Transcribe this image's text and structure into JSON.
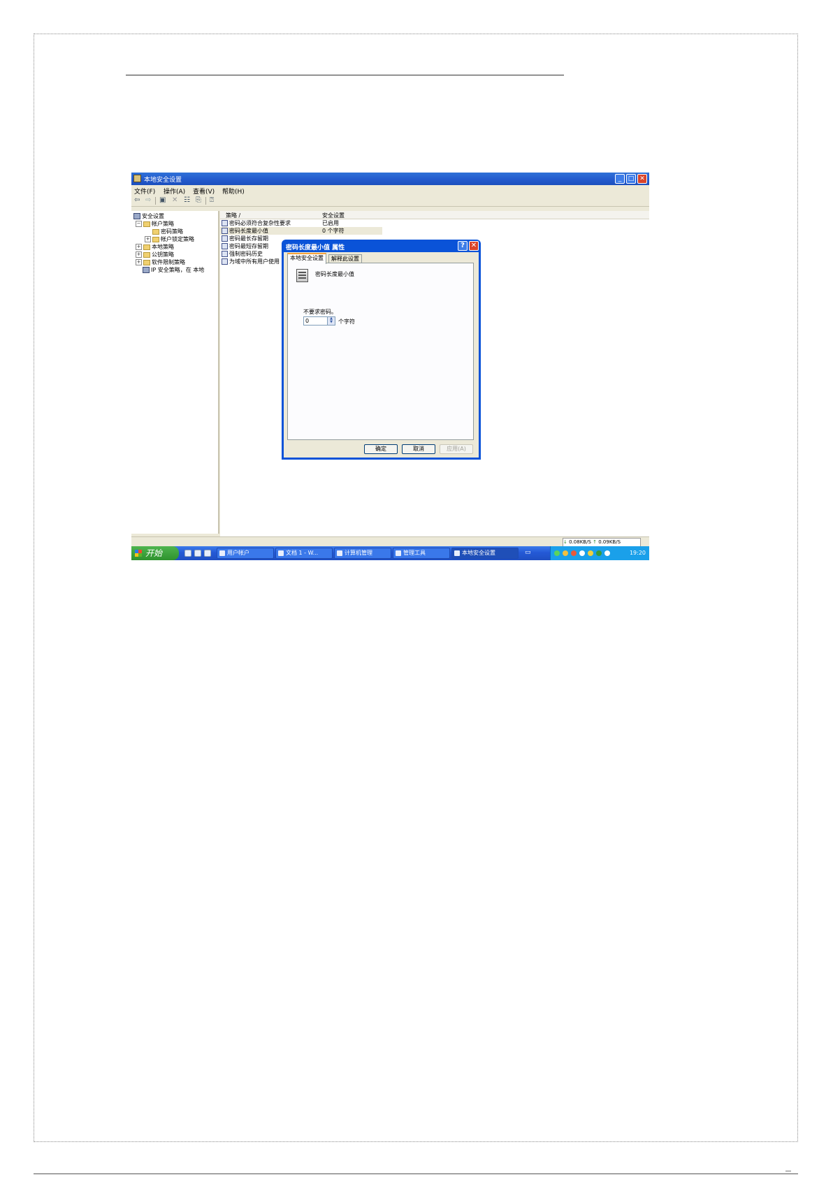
{
  "window": {
    "title": "本地安全设置",
    "min_label": "_",
    "max_label": "□",
    "close_label": "✕"
  },
  "menu": [
    "文件(F)",
    "操作(A)",
    "查看(V)",
    "帮助(H)"
  ],
  "toolbar_icons": [
    "back-arrow-icon",
    "forward-arrow-icon",
    "up-folder-icon",
    "delete-icon",
    "properties-icon",
    "export-icon",
    "help-icon"
  ],
  "tree": {
    "items": [
      {
        "label": "安全设置",
        "icon": "security-settings-icon"
      },
      {
        "label": "帐户策略",
        "icon": "folder-icon",
        "expander": "−"
      },
      {
        "label": "密码策略",
        "icon": "folder-icon"
      },
      {
        "label": "帐户锁定策略",
        "icon": "folder-icon",
        "expander": "+"
      },
      {
        "label": "本地策略",
        "icon": "folder-icon",
        "expander": "+"
      },
      {
        "label": "公钥策略",
        "icon": "folder-icon",
        "expander": "+"
      },
      {
        "label": "软件限制策略",
        "icon": "folder-icon",
        "expander": "+"
      },
      {
        "label": "IP 安全策略，在 本地",
        "icon": "ip-policy-icon"
      }
    ]
  },
  "list": {
    "columns": [
      "策略 /",
      "安全设置"
    ],
    "rows": [
      {
        "name": "密码必须符合复杂性要求",
        "value": "已启用"
      },
      {
        "name": "密码长度最小值",
        "value": "0 个字符"
      },
      {
        "name": "密码最长存留期",
        "value": ""
      },
      {
        "name": "密码最短存留期",
        "value": ""
      },
      {
        "name": "强制密码历史",
        "value": ""
      },
      {
        "name": "为域中所有用户使用",
        "value": ""
      }
    ]
  },
  "dialog": {
    "title": "密码长度最小值 属性",
    "help_label": "?",
    "close_label": "✕",
    "tabs": [
      "本地安全设置",
      "解释此设置"
    ],
    "policy_name": "密码长度最小值",
    "requirement_label": "不要求密码。",
    "value": "0",
    "unit": "个字符",
    "buttons": {
      "ok": "确定",
      "cancel": "取消",
      "apply": "应用(A)"
    }
  },
  "status": {
    "download": "0.08KB/S",
    "upload": "0.09KB/S"
  },
  "taskbar": {
    "start_label": "开始",
    "tasks": [
      "用户帐户",
      "文档 1 - W...",
      "计算机管理",
      "管理工具",
      "本地安全设置"
    ],
    "clock": "19:20"
  },
  "colors": {
    "xp_blue": "#245ccf",
    "start_green": "#3aa23a",
    "window_bg": "#ece9d8",
    "tray_blue": "#1aa0ea"
  }
}
